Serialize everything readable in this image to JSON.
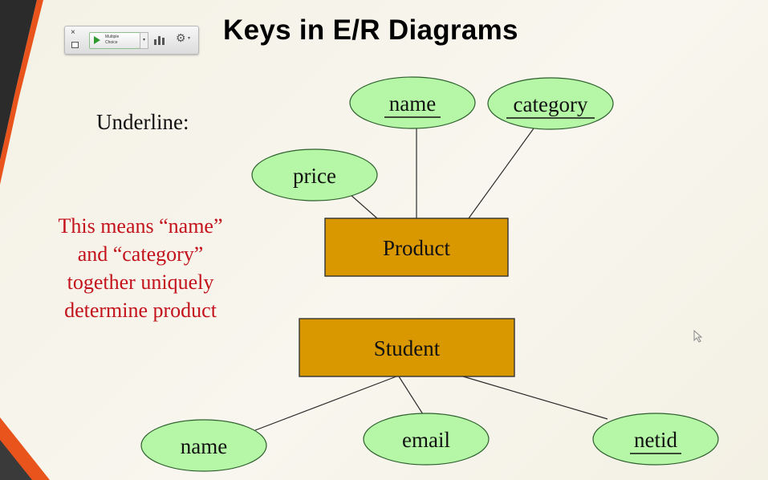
{
  "slide": {
    "title": "Keys in E/R Diagrams",
    "underline_label": "Underline:",
    "note_lines": [
      "This means “name”",
      "and “category”",
      "together uniquely",
      "determine product"
    ]
  },
  "toolbar": {
    "close_glyph": "×",
    "poll_label_line1": "Multiple",
    "poll_label_line2": "Choice",
    "dropdown_glyph": "▾",
    "gear_glyph": "⚙",
    "icons": [
      "close-icon",
      "minimize-icon",
      "play-icon",
      "chevron-down-icon",
      "bar-chart-icon",
      "gear-icon"
    ]
  },
  "diagram": {
    "entities": {
      "product": "Product",
      "student": "Student"
    },
    "product_attributes": {
      "name": "name",
      "category": "category",
      "price": "price"
    },
    "student_attributes": {
      "name": "name",
      "email": "email",
      "netid": "netid"
    },
    "key_attributes": [
      "product.name",
      "product.category",
      "student.netid"
    ]
  },
  "colors": {
    "attribute_fill": "#b5f7a6",
    "entity_fill": "#d99800",
    "note_text": "#c3121b",
    "accent_stripe": "#e8541c"
  }
}
